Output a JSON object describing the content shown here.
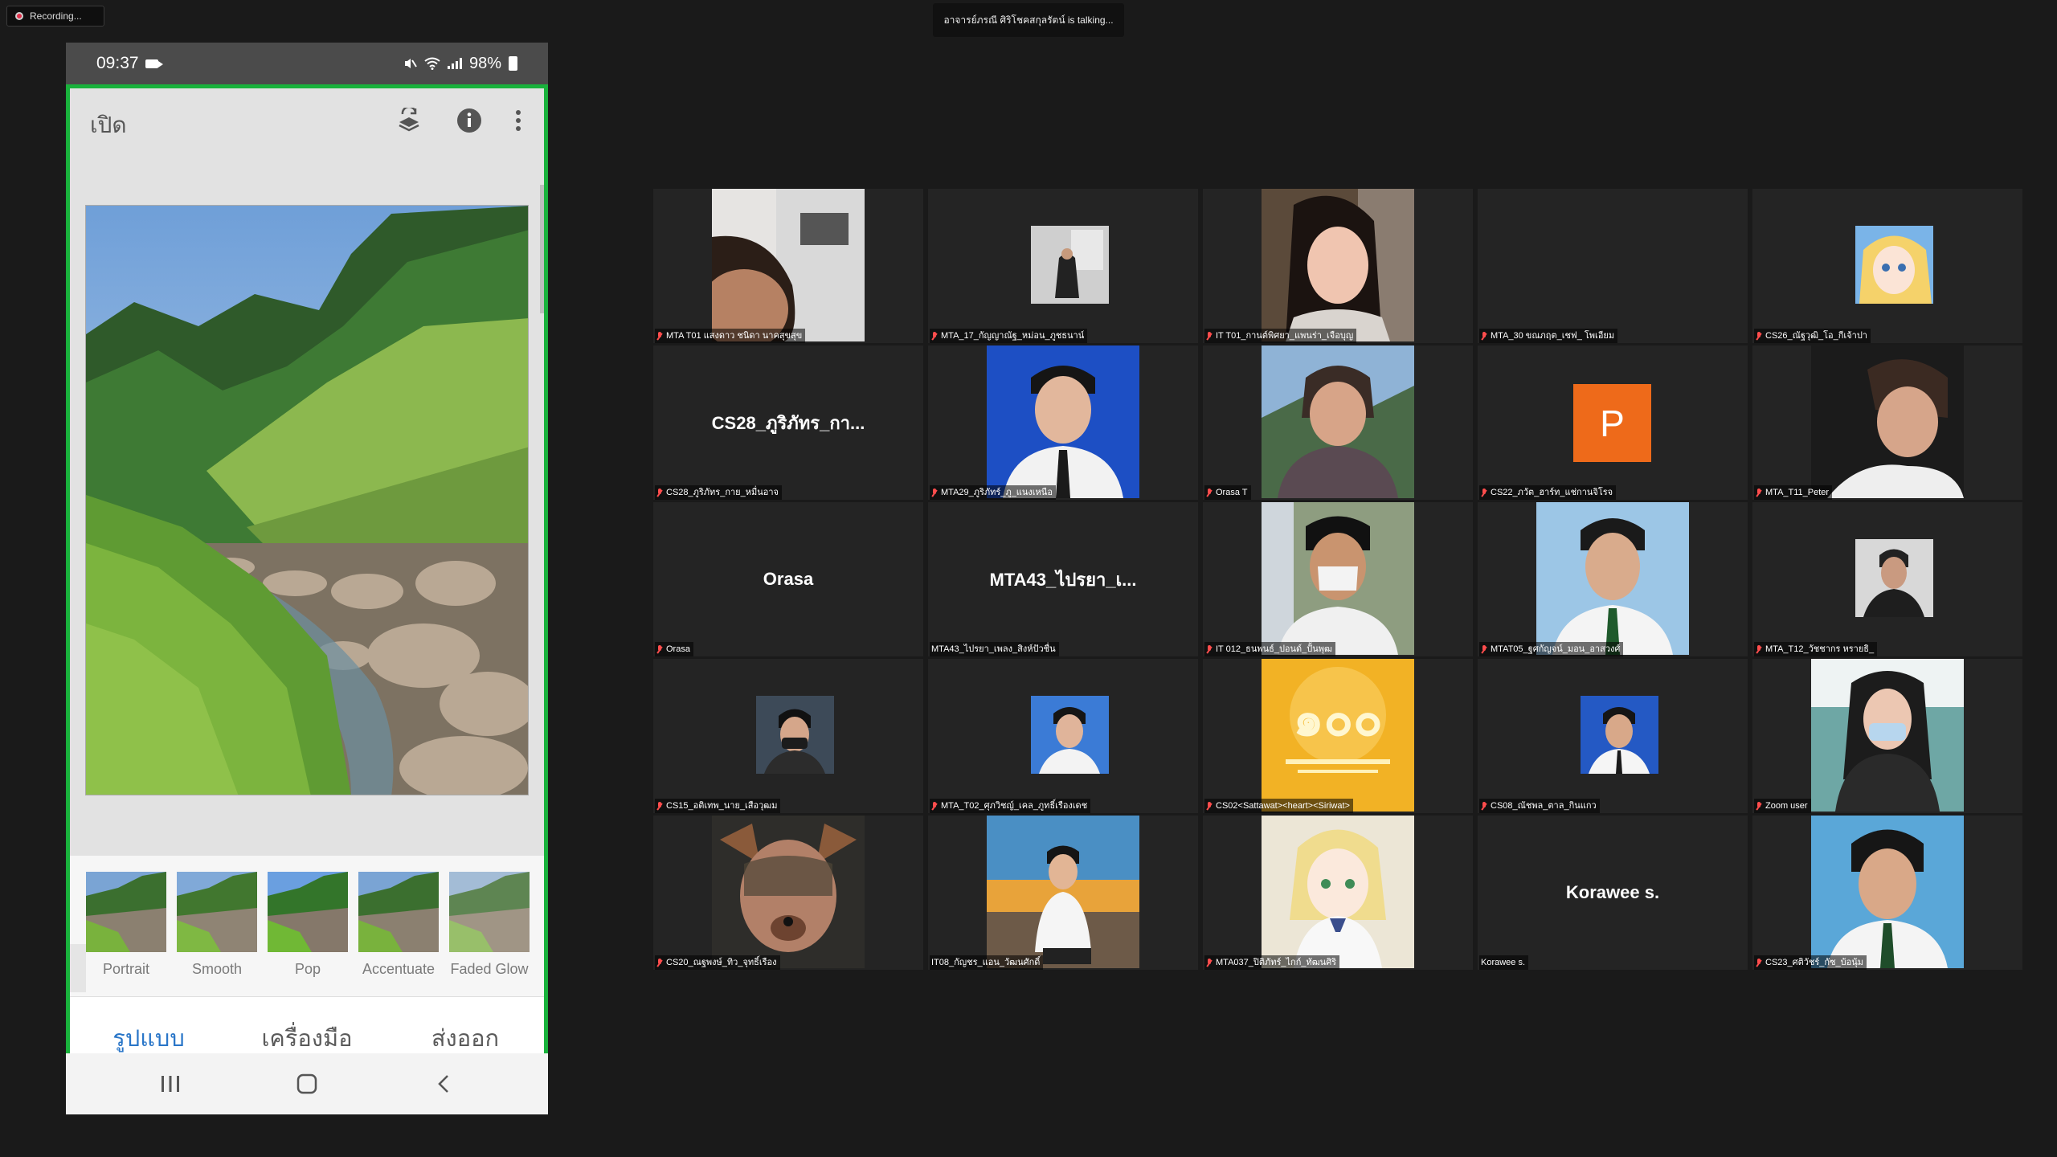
{
  "recording": {
    "label": "Recording..."
  },
  "talking": {
    "text": "อาจารย์ภรณี ศิริโชคสกุลรัตน์ is talking..."
  },
  "phone": {
    "status": {
      "time": "09:37",
      "battery": "98%"
    },
    "appbar": {
      "open_label": "เปิด"
    },
    "filters": [
      "Portrait",
      "Smooth",
      "Pop",
      "Accentuate",
      "Faded Glow"
    ],
    "tabs": [
      "รูปแบบ",
      "เครื่องมือ",
      "ส่งออก"
    ],
    "active_tab": "รูปแบบ"
  },
  "participants": [
    {
      "name": "MTA T01 แสงดาว ชนิดา นาคสุขสุข",
      "muted": true
    },
    {
      "name": "MTA_17_กัญญาณัฐ_หม่อน_ภูชธนาน์",
      "muted": true
    },
    {
      "name": "IT T01_กานต์พิศยา_แพนร่า_เจือบุญ",
      "muted": true
    },
    {
      "name": "MTA_30 ขณภฤต_เชฟ_ โพเอียม",
      "muted": true
    },
    {
      "name": "CS26_ณัฐวุฒิ_โอ_กีเจ้าปา",
      "muted": true
    },
    {
      "name": "CS28_ภูริภัทร_กาย_หมื่นอาจ",
      "muted": true,
      "big": "CS28_ภูริภัทร_กา..."
    },
    {
      "name": "MTA29_ภูริภัทร์_ภู_แนงเหนือ",
      "muted": true
    },
    {
      "name": "Orasa T",
      "muted": true
    },
    {
      "name": "CS22_ภวัต_ฮาร์ท_แช่กานจิโรจ",
      "muted": true,
      "avatar": "P"
    },
    {
      "name": "MTA_T11_Peter",
      "muted": true
    },
    {
      "name": "Orasa",
      "muted": true,
      "big": "Orasa"
    },
    {
      "name": "MTA43_ไปรยา_เพลง_สิงห์ปัวชื่น",
      "muted": false,
      "big": "MTA43_ไปรยา_เ..."
    },
    {
      "name": "IT 012_ธนพนธ์_ปอนด์_ปั้นพุฒ",
      "muted": true
    },
    {
      "name": "MTAT05_ฐศกัญจน์_มอน_อาสวงศ์",
      "muted": true
    },
    {
      "name": "MTA_T12_วัชชากร หรายธิ_",
      "muted": true
    },
    {
      "name": "CS15_อติเทพ_นาย_เสือวุฒม",
      "muted": true
    },
    {
      "name": "MTA_T02_ศุภวิชญ์_เคล_ภูทธิ์เรืองเดช",
      "muted": true
    },
    {
      "name": "CS02<Sattawat><heart><Siriwat>",
      "muted": true
    },
    {
      "name": "CS08_ณัชพล_ตาล_กินแกว",
      "muted": true
    },
    {
      "name": "Zoom user",
      "muted": true
    },
    {
      "name": "CS20_ณฐพงษ์_ทิว_จุทธิ์เรือง",
      "muted": true
    },
    {
      "name": "IT08_กัญชร_แอน_วัฒนศักดิ์",
      "muted": false
    },
    {
      "name": "MTA037_ปิติภัทร์_ไกก์_ทัฒนศิริ",
      "muted": true
    },
    {
      "name": "Korawee s.",
      "muted": false,
      "big": "Korawee s."
    },
    {
      "name": "CS23_ศติวัชร์_กัซ_บ้อนุ้ม",
      "muted": true
    }
  ],
  "colors": {
    "accent_green": "#19b23c",
    "tab_blue": "#2a76c8",
    "avatar_orange": "#ee6a1a"
  }
}
